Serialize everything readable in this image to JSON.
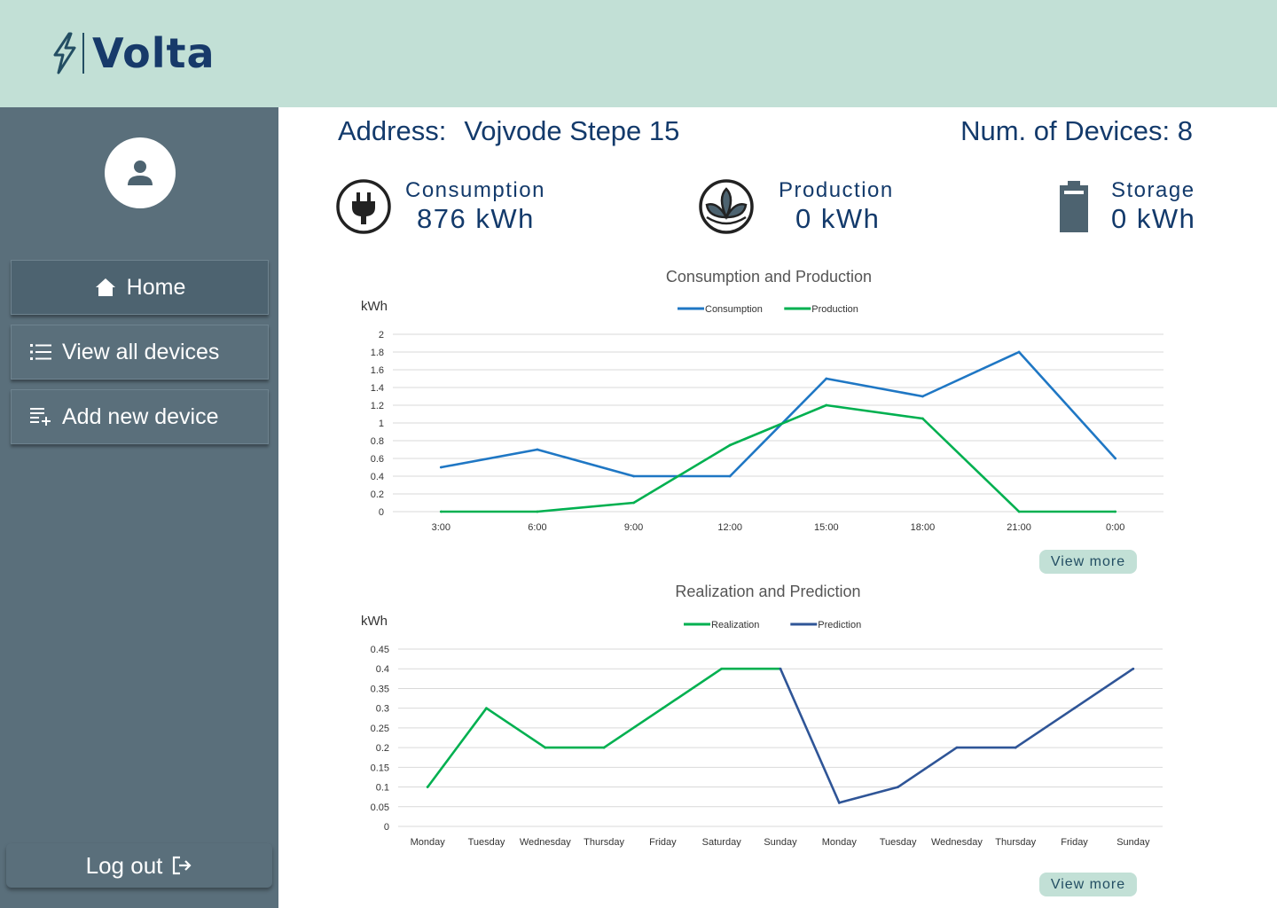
{
  "app": {
    "name": "Volta"
  },
  "sidebar": {
    "items": [
      {
        "label": "Home",
        "icon": "home-icon"
      },
      {
        "label": "View all devices",
        "icon": "list-icon"
      },
      {
        "label": "Add new device",
        "icon": "playlist-add-icon"
      }
    ],
    "logout_label": "Log out"
  },
  "overview": {
    "address_label": "Address:",
    "address_value": "Vojvode Stepe 15",
    "devices_label": "Num. of Devices:",
    "devices_value": "8",
    "consumption": {
      "label": "Consumption",
      "value": "876 kWh"
    },
    "production": {
      "label": "Production",
      "value": "0 kWh"
    },
    "storage": {
      "label": "Storage",
      "value": "0 kWh"
    }
  },
  "buttons": {
    "view_more": "View more"
  },
  "colors": {
    "header": "#c2e0d6",
    "sidebar": "#5a6f7b",
    "consumption": "#1f77c4",
    "production": "#00b050",
    "prediction": "#2f5597",
    "text": "#133a6b"
  },
  "chart_data": [
    {
      "type": "line",
      "title": "Consumption and Production",
      "ylabel": "kWh",
      "xlabel": "",
      "ylim": [
        0,
        2
      ],
      "yticks": [
        "0",
        "0.2",
        "0.4",
        "0.6",
        "0.8",
        "1",
        "1.2",
        "1.4",
        "1.6",
        "1.8",
        "2"
      ],
      "categories": [
        "3:00",
        "6:00",
        "9:00",
        "12:00",
        "15:00",
        "18:00",
        "21:00",
        "0:00"
      ],
      "legend": "top-center",
      "grid": true,
      "series": [
        {
          "name": "Consumption",
          "color": "#1f77c4",
          "values": [
            0.5,
            0.7,
            0.4,
            0.4,
            1.5,
            1.3,
            1.8,
            0.6
          ]
        },
        {
          "name": "Production",
          "color": "#00b050",
          "values": [
            0,
            0,
            0.1,
            0.75,
            1.2,
            1.05,
            0,
            0
          ]
        }
      ]
    },
    {
      "type": "line",
      "title": "Realization and Prediction",
      "ylabel": "kWh",
      "xlabel": "",
      "ylim": [
        0,
        0.45
      ],
      "yticks": [
        "0",
        "0.05",
        "0.1",
        "0.15",
        "0.2",
        "0.25",
        "0.3",
        "0.35",
        "0.4",
        "0.45"
      ],
      "categories": [
        "Monday",
        "Tuesday",
        "Wednesday",
        "Thursday",
        "Friday",
        "Saturday",
        "Sunday",
        "Monday",
        "Tuesday",
        "Wednesday",
        "Thursday",
        "Friday",
        "Sunday"
      ],
      "legend": "top-center",
      "grid": true,
      "series": [
        {
          "name": "Realization",
          "color": "#00b050",
          "values": [
            0.1,
            0.3,
            0.2,
            0.2,
            0.3,
            0.4,
            0.4,
            null,
            null,
            null,
            null,
            null,
            null
          ]
        },
        {
          "name": "Prediction",
          "color": "#2f5597",
          "values": [
            null,
            null,
            null,
            null,
            null,
            null,
            0.4,
            0.06,
            0.1,
            0.2,
            0.2,
            0.3,
            0.4
          ]
        }
      ]
    }
  ]
}
